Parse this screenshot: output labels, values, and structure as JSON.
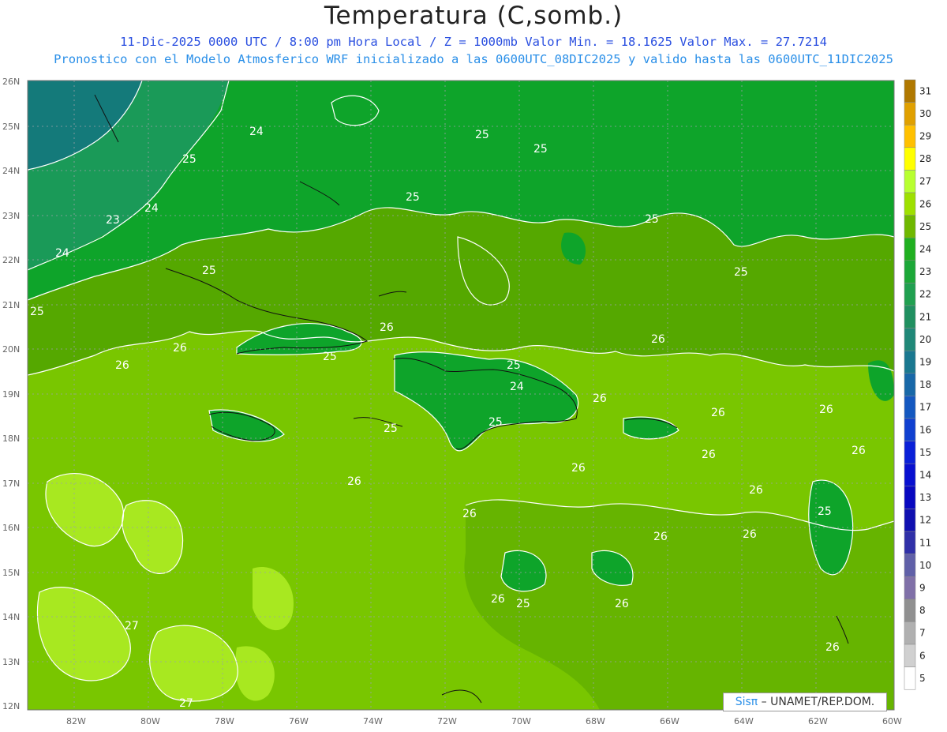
{
  "title": "Temperatura (C,somb.)",
  "subtitle_line1": "11-Dic-2025  0000 UTC / 8:00 pm Hora Local / Z = 1000mb   Valor Min. = 18.1625  Valor Max. = 27.7214",
  "subtitle_line2": "Pronostico con el Modelo Atmosferico WRF inicializado a las 0600UTC_08DIC2025 y valido hasta las  0600UTC_11DIC2025",
  "credit": {
    "sis": "Sisπ",
    "rest": " – UNAMET/REP.DOM."
  },
  "latitude_labels": [
    "26N",
    "25N",
    "24N",
    "23N",
    "22N",
    "21N",
    "20N",
    "19N",
    "18N",
    "17N",
    "16N",
    "15N",
    "14N",
    "13N",
    "12N"
  ],
  "longitude_labels": [
    "82W",
    "80W",
    "78W",
    "76W",
    "74W",
    "72W",
    "70W",
    "68W",
    "66W",
    "64W",
    "62W",
    "60W"
  ],
  "colorbar_labels": [
    "31",
    "30",
    "29",
    "28",
    "27",
    "26",
    "25",
    "24",
    "23",
    "22",
    "21",
    "20",
    "19",
    "18",
    "17",
    "16",
    "15",
    "14",
    "13",
    "12",
    "11",
    "10",
    "9",
    "8",
    "7",
    "6",
    "5"
  ],
  "colorbar_colors": [
    "#b07800",
    "#e0a000",
    "#ffc000",
    "#ffff00",
    "#b8ff30",
    "#9ee000",
    "#6fb800",
    "#20b020",
    "#1ca838",
    "#20a050",
    "#209060",
    "#208878",
    "#1a7890",
    "#1868a8",
    "#1458c0",
    "#1040d0",
    "#0a20d8",
    "#0810d0",
    "#0808c0",
    "#1010b0",
    "#3030a8",
    "#6060a8",
    "#8070a8",
    "#909090",
    "#b0b0b0",
    "#d0d0d0",
    "#ffffff"
  ],
  "contour_labels": [
    {
      "text": "24"
    },
    {
      "text": "25"
    },
    {
      "text": "25"
    },
    {
      "text": "25"
    },
    {
      "text": "24"
    },
    {
      "text": "23"
    },
    {
      "text": "24"
    },
    {
      "text": "25"
    },
    {
      "text": "25"
    },
    {
      "text": "25"
    },
    {
      "text": "25"
    },
    {
      "text": "26"
    },
    {
      "text": "26"
    },
    {
      "text": "26"
    },
    {
      "text": "25"
    },
    {
      "text": "25"
    },
    {
      "text": "24"
    },
    {
      "text": "25"
    },
    {
      "text": "25"
    },
    {
      "text": "26"
    },
    {
      "text": "26"
    },
    {
      "text": "26"
    },
    {
      "text": "26"
    },
    {
      "text": "26"
    },
    {
      "text": "26"
    },
    {
      "text": "26"
    },
    {
      "text": "26"
    },
    {
      "text": "26"
    },
    {
      "text": "26"
    },
    {
      "text": "25"
    },
    {
      "text": "26"
    },
    {
      "text": "26"
    },
    {
      "text": "26"
    },
    {
      "text": "25"
    },
    {
      "text": "26"
    },
    {
      "text": "26"
    },
    {
      "text": "27"
    },
    {
      "text": "27"
    }
  ],
  "colors": {
    "band24": "#0ea42a",
    "band25": "#55a800",
    "band26": "#79c600",
    "band27": "#a8e820",
    "band23": "#1a9a58",
    "deep": "#147a7a"
  }
}
